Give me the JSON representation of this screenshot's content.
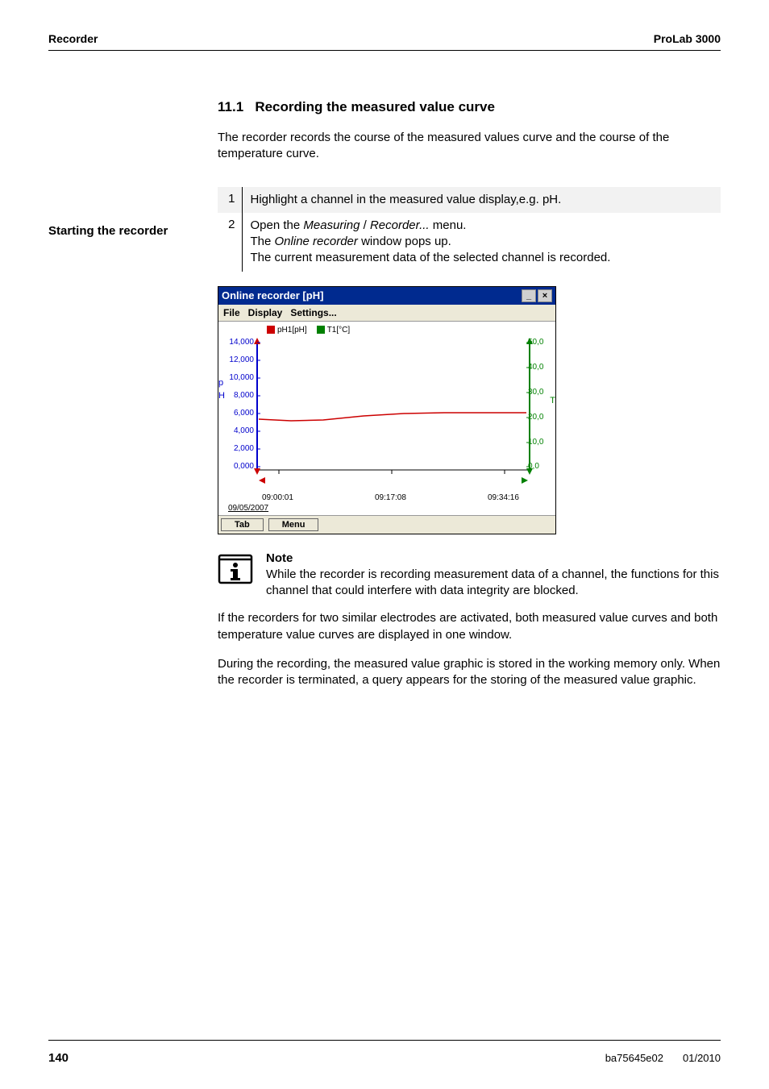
{
  "header": {
    "left": "Recorder",
    "right": "ProLab 3000"
  },
  "section": {
    "number": "11.1",
    "title": "Recording the measured value curve",
    "intro": "The recorder records the course of the measured values curve and the course of the temperature curve."
  },
  "margin_label": "Starting the recorder",
  "steps": [
    {
      "num": "1",
      "text": "Highlight a channel in the measured value display,e.g. pH."
    },
    {
      "num": "2",
      "text_pre": "Open the ",
      "italic1": "Measuring",
      "mid1": " / ",
      "italic2": "Recorder...",
      "mid2": " menu.\nThe ",
      "italic3": "Online recorder",
      "text_post": " window pops up.\nThe current measurement data of the selected channel is recorded."
    }
  ],
  "screenshot": {
    "title": "Online recorder [pH]",
    "menus": [
      "File",
      "Display",
      "Settings..."
    ],
    "tab_btn": "Tab",
    "menu_btn": "Menu",
    "legend": [
      {
        "label": "pH1[pH]",
        "color": "#cc0000"
      },
      {
        "label": "T1[°C]",
        "color": "#008000"
      }
    ],
    "date": "09/05/2007"
  },
  "chart_data": {
    "type": "line",
    "title": "Online recorder [pH]",
    "x_type": "time",
    "x_ticks": [
      "09:00:01",
      "09:17:08",
      "09:34:16"
    ],
    "left_axis": {
      "label": "pH",
      "range": [
        0,
        14
      ],
      "ticks": [
        0,
        2000,
        4000,
        6000,
        8000,
        10000,
        12000,
        14000
      ],
      "tick_labels": [
        "0,000",
        "2,000",
        "4,000",
        "6,000",
        "8,000",
        "10,000",
        "12,000",
        "14,000"
      ]
    },
    "right_axis": {
      "label": "T",
      "range": [
        0,
        50
      ],
      "ticks": [
        0,
        10,
        20,
        30,
        40,
        50
      ],
      "tick_labels": [
        "0,0",
        "10,0",
        "20,0",
        "30,0",
        "40,0",
        "50,0"
      ]
    },
    "series": [
      {
        "name": "pH1[pH]",
        "axis": "left",
        "color": "#cc0000",
        "x": [
          "09:00",
          "09:05",
          "09:10",
          "09:15",
          "09:20",
          "09:25",
          "09:30",
          "09:35"
        ],
        "y": [
          5.6,
          5.4,
          5.5,
          5.8,
          6.0,
          6.1,
          6.1,
          6.1
        ]
      }
    ],
    "legend_position": "top"
  },
  "note": {
    "heading": "Note",
    "text": "While the recorder is recording measurement data of a channel, the functions for this channel that could interfere with data integrity are blocked."
  },
  "para2": "If the recorders for two similar electrodes are activated, both measured value curves and both temperature value curves are displayed in one window.",
  "para3": "During the recording, the measured value graphic is stored in the working memory only. When the recorder is terminated, a query appears for the storing of the measured value graphic.",
  "footer": {
    "page": "140",
    "doc": "ba75645e02",
    "date": "01/2010"
  }
}
